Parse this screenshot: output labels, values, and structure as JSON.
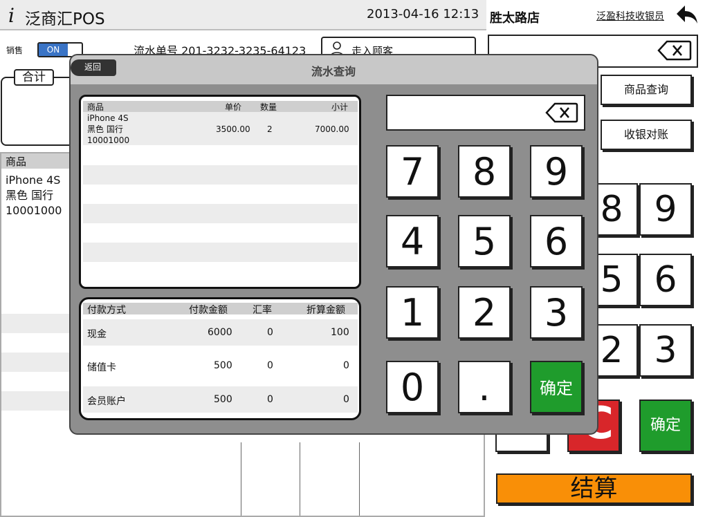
{
  "app": {
    "logo": "i",
    "title": "泛商汇POS",
    "datetime": "2013-04-16 12:13"
  },
  "sale": {
    "label": "销售",
    "toggle": "ON",
    "serial_text": "流水单号 201-3232-3235-64123",
    "customer": "走入顾客",
    "total_label": "合计"
  },
  "bg_list": {
    "header": "商品",
    "item_lines": [
      "iPhone 4S",
      "黑色 国行",
      "10001000"
    ]
  },
  "right": {
    "store": "胜太路店",
    "cashier": "泛盈科技收银员",
    "buttons": [
      "商品查询",
      "收银对账"
    ],
    "keys": [
      "9",
      "6",
      "3"
    ],
    "partial_keys": [
      "8",
      "5",
      "2"
    ],
    "confirm": "确定",
    "settle": "结算"
  },
  "modal": {
    "title": "流水查询",
    "back": "返回",
    "order": {
      "columns": [
        "商品",
        "单价",
        "数量",
        "小计"
      ],
      "item": {
        "lines": [
          "iPhone 4S",
          "黑色 国行",
          "10001000"
        ],
        "price": "3500.00",
        "qty": "2",
        "subtotal": "7000.00"
      }
    },
    "payments": {
      "columns": [
        "付款方式",
        "付款金额",
        "汇率",
        "折算金额"
      ],
      "rows": [
        {
          "method": "现金",
          "amount": "6000",
          "rate": "0",
          "converted": "100"
        },
        {
          "method": "储值卡",
          "amount": "500",
          "rate": "0",
          "converted": "0"
        },
        {
          "method": "会员账户",
          "amount": "500",
          "rate": "0",
          "converted": "0"
        }
      ]
    },
    "keypad": {
      "keys": [
        "7",
        "8",
        "9",
        "4",
        "5",
        "6",
        "1",
        "2",
        "3",
        "0",
        "."
      ],
      "confirm": "确定"
    }
  }
}
